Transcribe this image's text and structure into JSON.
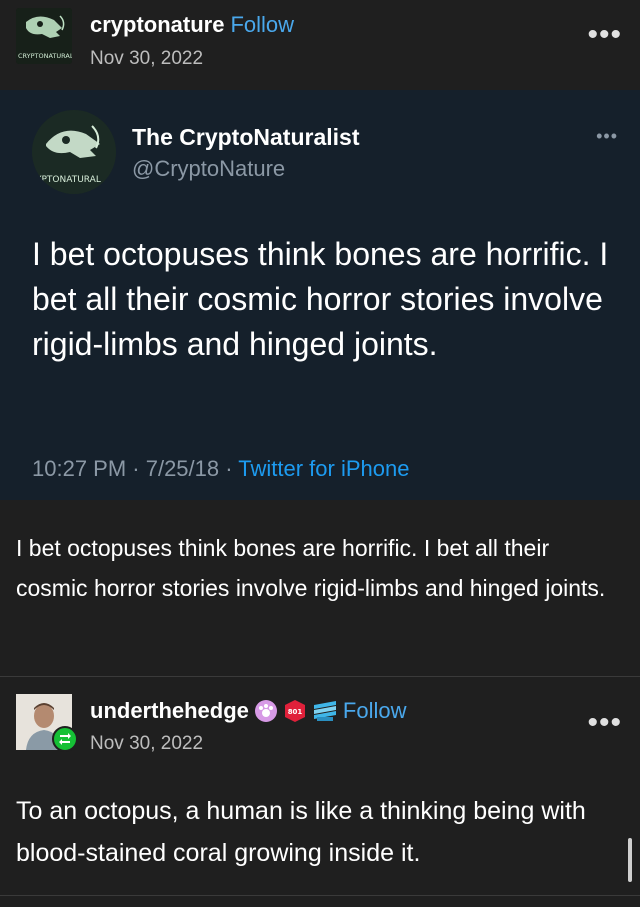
{
  "post": {
    "blog_name": "cryptonature",
    "follow_label": "Follow",
    "date": "Nov 30, 2022",
    "more_label": "•••",
    "avatar_text": "CRYPTONATURALIST"
  },
  "tweet": {
    "display_name": "The CryptoNaturalist",
    "handle": "@CryptoNature",
    "more_label": "•••",
    "avatar_text": "YPTONATURAL",
    "text": "I bet octopuses think bones are horrific. I bet all their cosmic horror stories involve rigid-limbs and hinged joints.",
    "meta_time": "10:27 PM · 7/25/18 · ",
    "meta_source": "Twitter for iPhone"
  },
  "caption": {
    "text": "I bet octopuses think bones are horrific. I bet all their cosmic horror stories involve rigid-limbs and hinged joints."
  },
  "reblog": {
    "blog_name": "underthehedge",
    "follow_label": "Follow",
    "date": "Nov 30, 2022",
    "more_label": "•••",
    "badge_text": "801",
    "text": "To an octopus, a human is like a thinking being with blood-stained coral growing inside it."
  },
  "colors": {
    "page_bg": "#1f1f1f",
    "tweet_bg": "#15202b",
    "follow_blue": "#4aa8ec",
    "twitter_blue": "#1d9bf0",
    "reblog_green": "#15c035"
  }
}
